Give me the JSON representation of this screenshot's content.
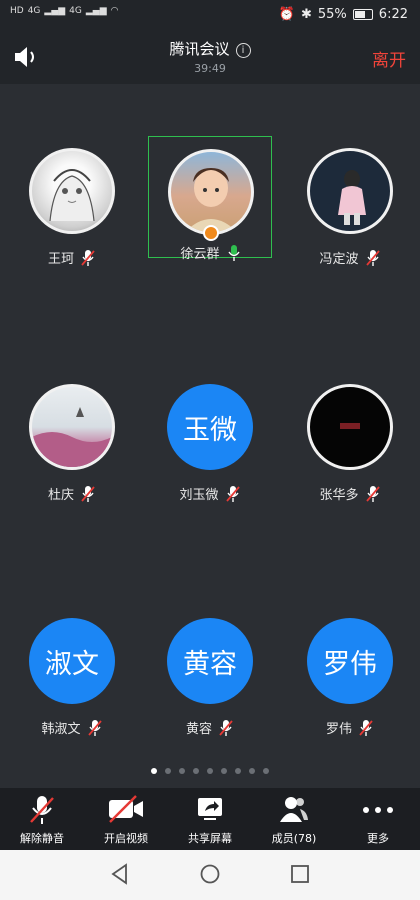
{
  "status_bar": {
    "left_indicators": [
      "HD",
      "4G",
      "4G",
      "HD"
    ],
    "battery": "55%",
    "time": "6:22"
  },
  "header": {
    "title": "腾讯会议",
    "timer": "39:49",
    "leave_label": "离开"
  },
  "participants": [
    {
      "name": "王珂",
      "avatar_type": "photo",
      "avatar_text": "",
      "mic": "muted",
      "active": false,
      "host": false
    },
    {
      "name": "徐云群",
      "avatar_type": "photo",
      "avatar_text": "",
      "mic": "on",
      "active": true,
      "host": true
    },
    {
      "name": "冯定波",
      "avatar_type": "photo",
      "avatar_text": "",
      "mic": "muted",
      "active": false,
      "host": false
    },
    {
      "name": "杜庆",
      "avatar_type": "photo",
      "avatar_text": "",
      "mic": "muted",
      "active": false,
      "host": false
    },
    {
      "name": "刘玉微",
      "avatar_type": "text",
      "avatar_text": "玉微",
      "mic": "muted",
      "active": false,
      "host": false
    },
    {
      "name": "张华多",
      "avatar_type": "photo",
      "avatar_text": "",
      "mic": "muted",
      "active": false,
      "host": false
    },
    {
      "name": "韩淑文",
      "avatar_type": "text",
      "avatar_text": "淑文",
      "mic": "muted",
      "active": false,
      "host": false
    },
    {
      "name": "黄容",
      "avatar_type": "text",
      "avatar_text": "黄容",
      "mic": "muted",
      "active": false,
      "host": false
    },
    {
      "name": "罗伟",
      "avatar_type": "text",
      "avatar_text": "罗伟",
      "mic": "muted",
      "active": false,
      "host": false
    }
  ],
  "pagination": {
    "total": 9,
    "current": 1
  },
  "toolbar": {
    "unmute": "解除静音",
    "start_video": "开启视频",
    "share_screen": "共享屏幕",
    "members": "成员(78)",
    "more": "更多"
  },
  "colors": {
    "accent": "#1b86f5",
    "leave": "#f0443a",
    "active_border": "#2fbf4f",
    "mute_red": "#e53935"
  }
}
